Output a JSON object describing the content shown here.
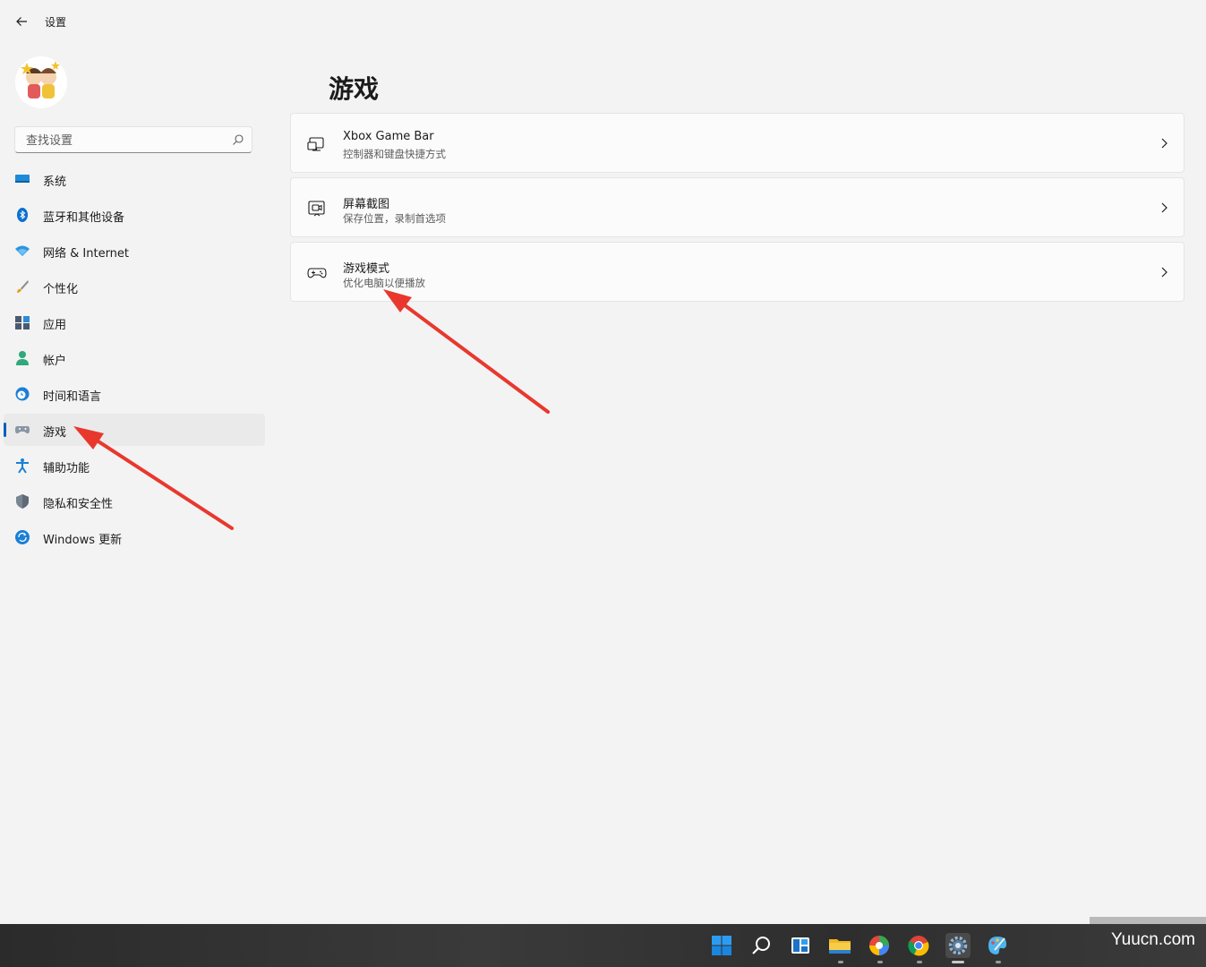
{
  "window": {
    "title": "设置"
  },
  "search": {
    "placeholder": "查找设置"
  },
  "sidebar": {
    "items": [
      {
        "label": "系统",
        "icon": "monitor-icon",
        "color": "#0067c0"
      },
      {
        "label": "蓝牙和其他设备",
        "icon": "bluetooth-icon",
        "color": "#0067c0"
      },
      {
        "label": "网络 & Internet",
        "icon": "wifi-icon",
        "color": "#1a8ad4"
      },
      {
        "label": "个性化",
        "icon": "brush-icon",
        "color": "#e3a21a"
      },
      {
        "label": "应用",
        "icon": "apps-icon",
        "color": "#4a5a6e"
      },
      {
        "label": "帐户",
        "icon": "person-icon",
        "color": "#2fa87d"
      },
      {
        "label": "时间和语言",
        "icon": "globe-clock-icon",
        "color": "#1a7fd6"
      },
      {
        "label": "游戏",
        "icon": "gamepad-icon",
        "color": "#6b7785",
        "active": true
      },
      {
        "label": "辅助功能",
        "icon": "accessibility-icon",
        "color": "#1a7fd6"
      },
      {
        "label": "隐私和安全性",
        "icon": "shield-icon",
        "color": "#7a8592"
      },
      {
        "label": "Windows 更新",
        "icon": "sync-icon",
        "color": "#1a7fd6"
      }
    ]
  },
  "main": {
    "title": "游戏",
    "cards": [
      {
        "title": "Xbox Game Bar",
        "subtitle": "控制器和键盘快捷方式",
        "icon": "game-bar-icon"
      },
      {
        "title": "屏幕截图",
        "subtitle": "保存位置，录制首选项",
        "icon": "capture-icon"
      },
      {
        "title": "游戏模式",
        "subtitle": "优化电脑以便播放",
        "icon": "gamepad-icon"
      }
    ]
  },
  "taskbar": {
    "icons": [
      "windows-start-icon",
      "search-icon",
      "widgets-icon",
      "file-explorer-icon",
      "color-picker-app-icon",
      "chrome-icon",
      "settings-icon",
      "paint-icon"
    ],
    "active": "settings-icon"
  },
  "watermark": "Yuucn.com"
}
